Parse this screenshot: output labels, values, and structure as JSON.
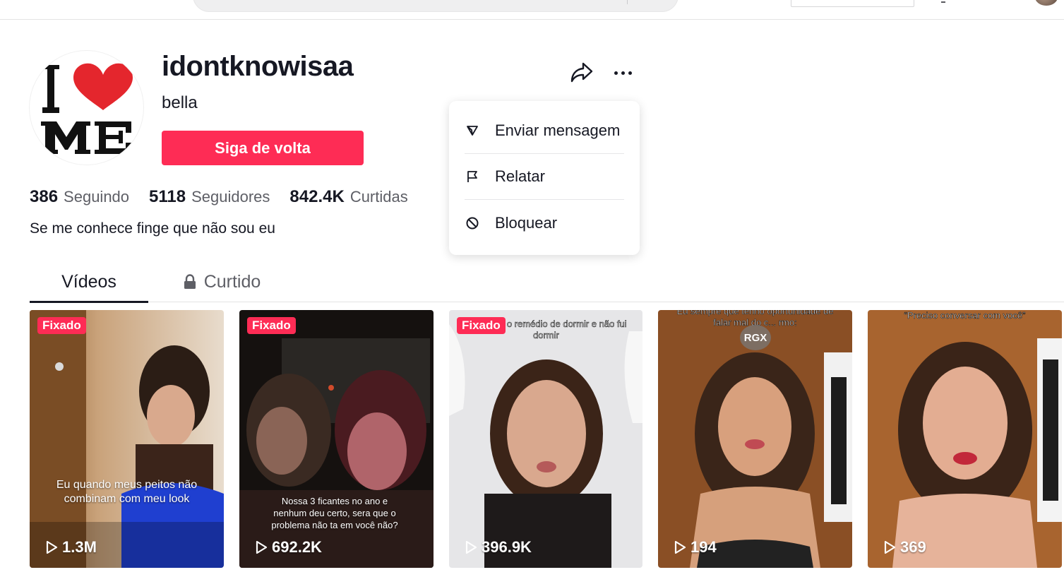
{
  "profile": {
    "username": "idontknowisaa",
    "nickname": "bella",
    "follow_button": "Siga de volta",
    "bio": "Se me conhece finge que não sou eu",
    "avatar_text": "I ❤ ME",
    "stats": [
      {
        "value": "386",
        "label": "Seguindo"
      },
      {
        "value": "5118",
        "label": "Seguidores"
      },
      {
        "value": "842.4K",
        "label": "Curtidas"
      }
    ]
  },
  "actions": {
    "share_icon": "share-icon",
    "more_icon": "more-options-icon"
  },
  "menu": {
    "items": [
      {
        "label": "Enviar mensagem",
        "icon": "send-icon"
      },
      {
        "label": "Relatar",
        "icon": "flag-icon"
      },
      {
        "label": "Bloquear",
        "icon": "block-icon"
      }
    ]
  },
  "tabs": [
    {
      "label": "Vídeos",
      "active": true
    },
    {
      "label": "Curtido",
      "icon": "lock-icon",
      "active": false
    }
  ],
  "videos": [
    {
      "pinned_label": "Fixado",
      "views": "1.3M",
      "caption": "Eu quando meus peitos não combinam com meu look"
    },
    {
      "pinned_label": "Fixado",
      "views": "692.2K",
      "caption": "Nossa 3 ficantes no ano e nenhum deu certo, sera que o problema não ta em você não?"
    },
    {
      "pinned_label": "Fixado",
      "views": "396.9K",
      "caption": "Eu: tomei o remédio de dormir e não fui dormir"
    },
    {
      "views": "194",
      "caption": "Eu sempre que tenho oportunidade de falar mal do c... rmo:",
      "badge": "RGX"
    },
    {
      "views": "369",
      "caption": "“Preciso conversar com você”"
    }
  ],
  "colors": {
    "accent": "#fe2c55",
    "text": "#161823",
    "secondary_text": "#5e5f66"
  }
}
